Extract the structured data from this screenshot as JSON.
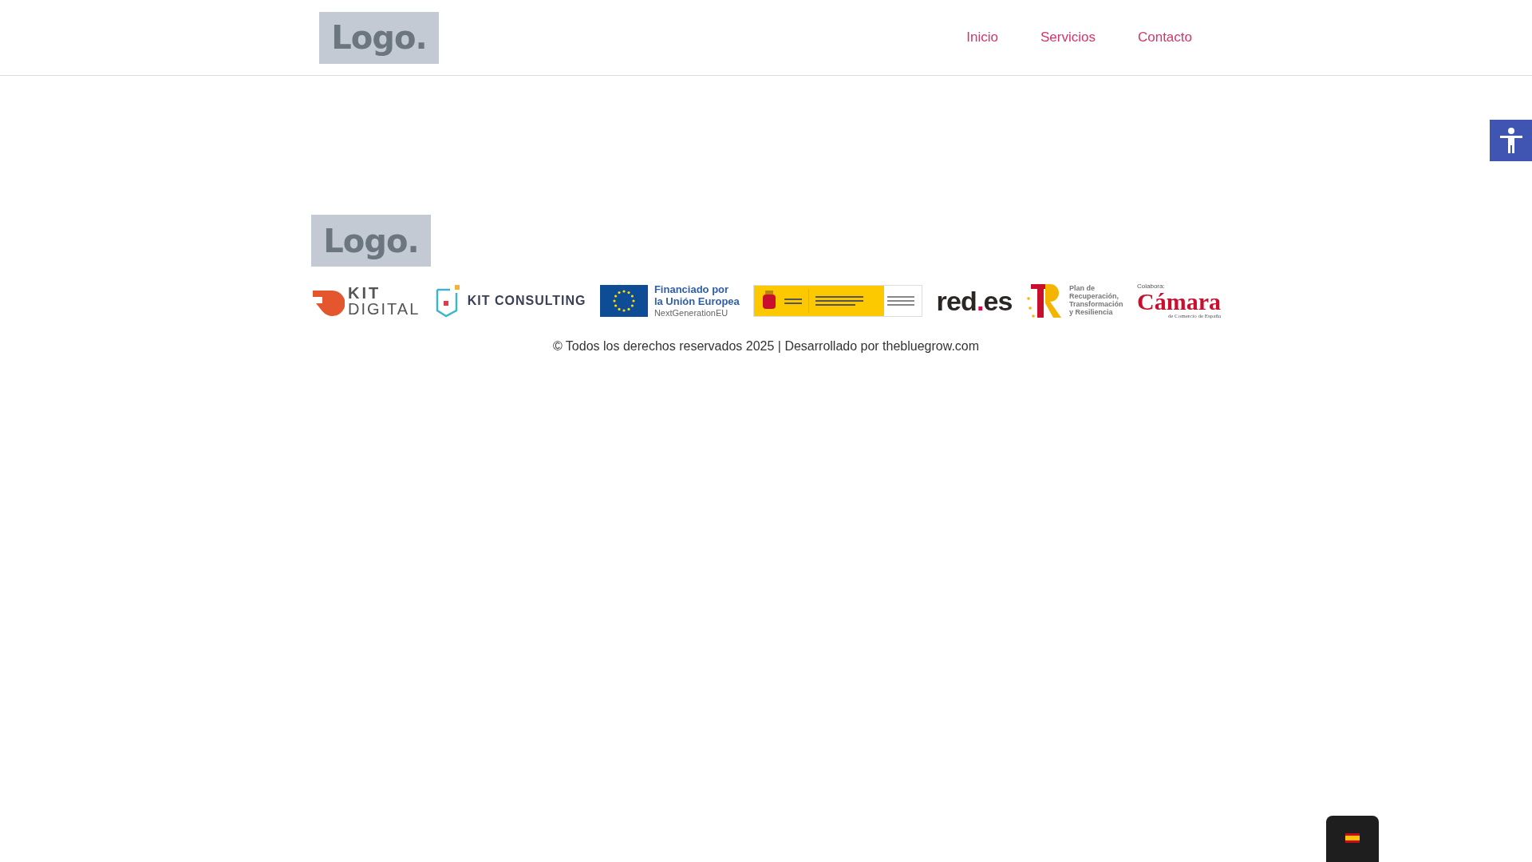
{
  "header": {
    "logo": "Logo.",
    "nav": [
      {
        "label": "Inicio"
      },
      {
        "label": "Servicios"
      },
      {
        "label": "Contacto"
      }
    ]
  },
  "footer": {
    "logo": "Logo.",
    "sponsors": [
      {
        "kind": "kit_digital",
        "lines": [
          "KIT",
          "DIGITAL"
        ]
      },
      {
        "kind": "kit_consulting",
        "lines": [
          "KIT CONSULTING"
        ]
      },
      {
        "kind": "eu",
        "lines": [
          "Financiado por",
          "la Unión Europea",
          "NextGenerationEU"
        ]
      },
      {
        "kind": "gobierno"
      },
      {
        "kind": "red_es",
        "lines": [
          "red",
          ".",
          "es"
        ]
      },
      {
        "kind": "plan",
        "lines": [
          "Plan de",
          "Recuperación,",
          "Transformación",
          "y Resiliencia"
        ]
      },
      {
        "kind": "camara",
        "lines": [
          "Colabora:",
          "Cámara",
          "de Comercio de España"
        ]
      }
    ],
    "copyright": "© Todos los derechos reservados 2025 | Desarrollado por thebluegrow.com"
  }
}
